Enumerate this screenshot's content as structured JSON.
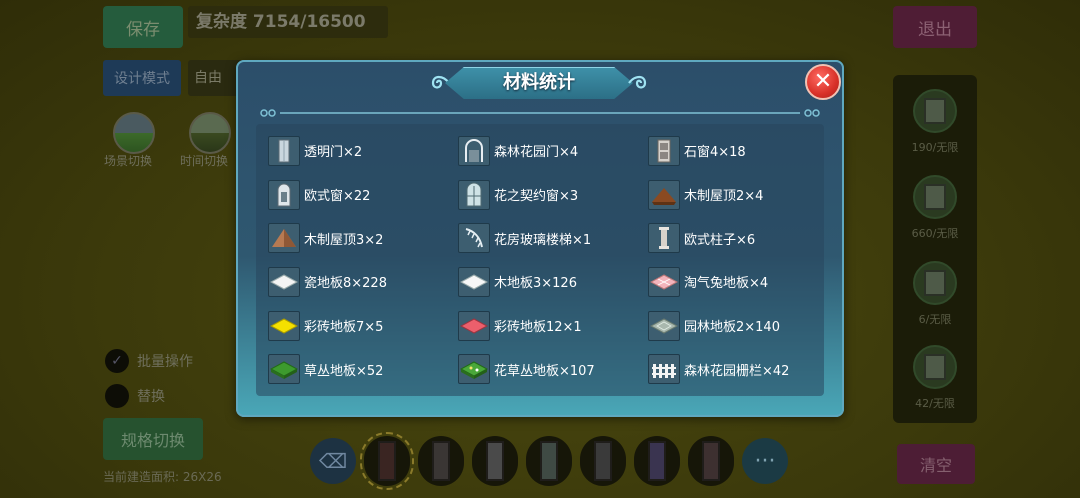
{
  "background": {
    "save_label": "保存",
    "complexity_label": "复杂度 7154/16500",
    "exit_label": "退出",
    "design_mode_label": "设计模式",
    "free_label": "自由",
    "scene_switch_label": "场景切换",
    "time_switch_label": "时间切换",
    "batch_label": "批量操作",
    "replace_label": "替换",
    "spec_switch_label": "规格切换",
    "area_label": "当前建造面积: 26X26",
    "clear_label": "清空",
    "right_panel": [
      {
        "label": "190/无限"
      },
      {
        "label": "660/无限"
      },
      {
        "label": "6/无限"
      },
      {
        "label": "42/无限"
      }
    ],
    "more_label": "···"
  },
  "modal": {
    "title": "材料统计",
    "close_label": "✕",
    "items": [
      {
        "label": "透明门×2",
        "icon": "glass-door-icon"
      },
      {
        "label": "森林花园门×4",
        "icon": "garden-gate-icon"
      },
      {
        "label": "石窗4×18",
        "icon": "stone-window-icon"
      },
      {
        "label": "欧式窗×22",
        "icon": "european-window-icon"
      },
      {
        "label": "花之契约窗×3",
        "icon": "flower-window-icon"
      },
      {
        "label": "木制屋顶2×4",
        "icon": "wood-roof-dark-icon"
      },
      {
        "label": "木制屋顶3×2",
        "icon": "wood-roof-light-icon"
      },
      {
        "label": "花房玻璃楼梯×1",
        "icon": "glass-stairs-icon"
      },
      {
        "label": "欧式柱子×6",
        "icon": "pillar-icon"
      },
      {
        "label": "瓷地板8×228",
        "icon": "white-tile-icon"
      },
      {
        "label": "木地板3×126",
        "icon": "wood-floor-icon"
      },
      {
        "label": "淘气兔地板×4",
        "icon": "bunny-floor-icon"
      },
      {
        "label": "彩砖地板7×5",
        "icon": "yellow-tile-icon"
      },
      {
        "label": "彩砖地板12×1",
        "icon": "red-tile-icon"
      },
      {
        "label": "园林地板2×140",
        "icon": "garden-floor-icon"
      },
      {
        "label": "草丛地板×52",
        "icon": "grass-floor-icon"
      },
      {
        "label": "花草丛地板×107",
        "icon": "flower-grass-floor-icon"
      },
      {
        "label": "森林花园栅栏×42",
        "icon": "fence-icon"
      }
    ]
  }
}
